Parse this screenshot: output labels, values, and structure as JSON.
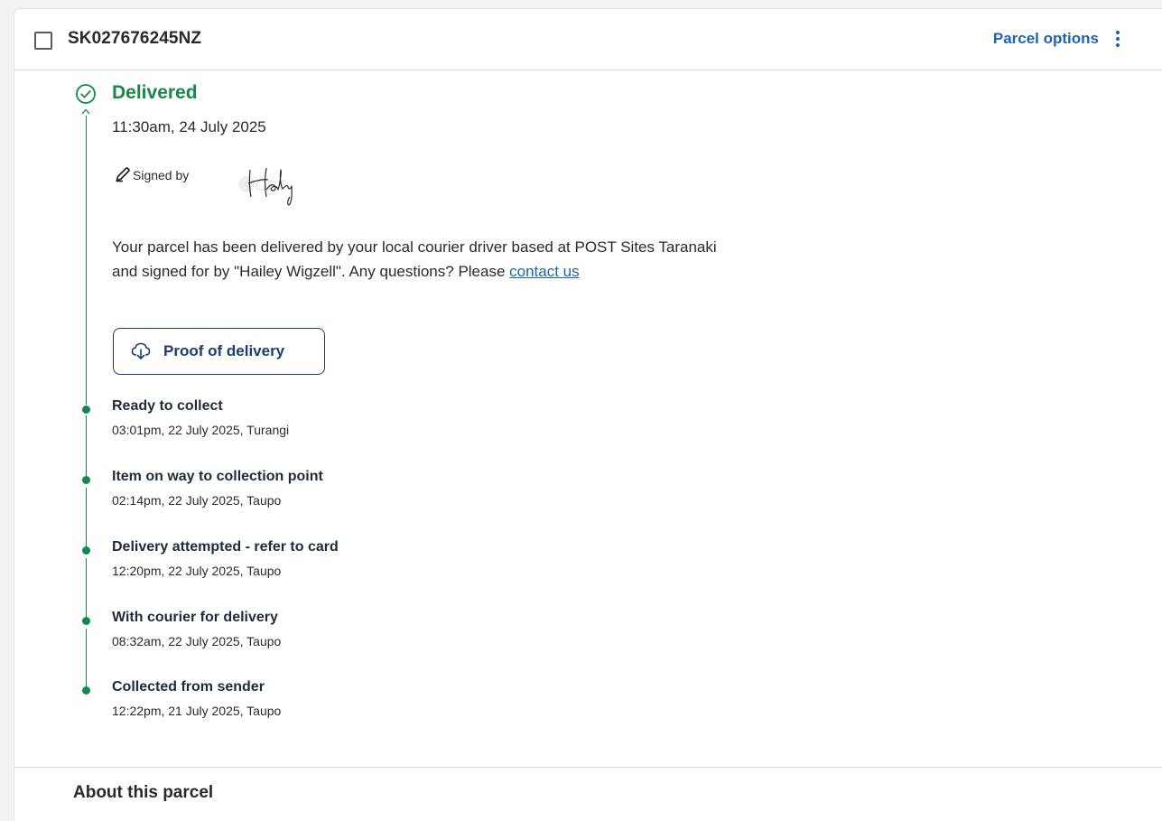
{
  "parcel": {
    "tracking_number": "SK027676245NZ",
    "options_label": "Parcel options"
  },
  "status": {
    "title": "Delivered",
    "time": "11:30am, 24 July 2025",
    "signed_by_label": "Signed by",
    "description_part1": "Your parcel has been delivered by your local courier driver based at POST Sites Taranaki and signed for by \"Hailey Wigzell\". Any questions? Please ",
    "contact_link": "contact us",
    "proof_button": "Proof of delivery"
  },
  "events": [
    {
      "title": "Ready to collect",
      "meta": "03:01pm, 22 July 2025, Turangi"
    },
    {
      "title": "Item on way to collection point",
      "meta": "02:14pm, 22 July 2025, Taupo"
    },
    {
      "title": "Delivery attempted - refer to card",
      "meta": "12:20pm, 22 July 2025, Taupo"
    },
    {
      "title": "With courier for delivery",
      "meta": "08:32am, 22 July 2025, Taupo"
    },
    {
      "title": "Collected from sender",
      "meta": "12:22pm, 21 July 2025, Taupo"
    }
  ],
  "about": {
    "title": "About this parcel"
  },
  "colors": {
    "accent_green": "#17874a",
    "link_blue": "#1c63b7",
    "button_navy": "#1c3e6b"
  },
  "icons": {
    "status": "check-circle-icon",
    "signed": "pencil-icon",
    "proof": "cloud-download-icon",
    "options": "kebab-menu-icon"
  }
}
